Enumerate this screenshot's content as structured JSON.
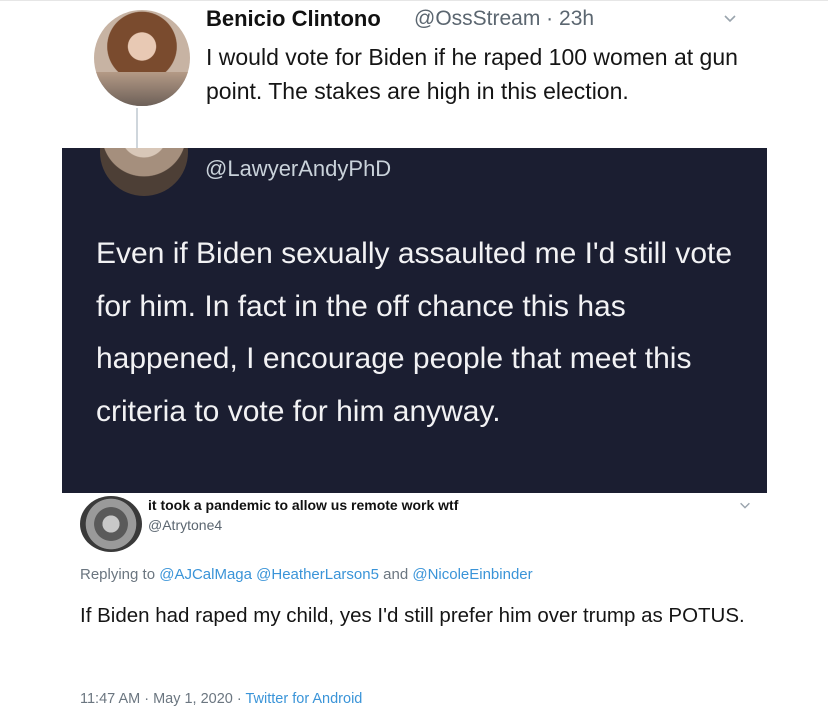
{
  "tweet1": {
    "name": "Benicio Clintono",
    "handle": "@OssStream",
    "separator": " · ",
    "time": "23h",
    "text": "I would vote for Biden if he raped 100 women at gun point. The stakes are high in this election."
  },
  "tweet2": {
    "handle": "@LawyerAndyPhD",
    "text": "Even if Biden sexually assaulted me I'd still vote for him. In fact in the off chance this has happened, I encourage people that meet this criteria to vote for him anyway."
  },
  "tweet3": {
    "name": "it took a pandemic to allow us remote work wtf",
    "handle": "@Atrytone4",
    "replying_label": "Replying to",
    "mentions": [
      "@AJCalMaga",
      "@HeatherLarson5",
      "and",
      "@NicoleEinbinder"
    ],
    "text": "If Biden had raped my child, yes I'd still prefer him over trump as POTUS.",
    "timestamp": "11:47 AM · May 1, 2020",
    "footer_sep": " · ",
    "source": "Twitter for Android"
  },
  "colors": {
    "dark_bg": "#1b1e31",
    "meta_gray": "#5b6670",
    "link_blue": "#3a94d8"
  },
  "icons": [
    "chevron-down-icon"
  ]
}
